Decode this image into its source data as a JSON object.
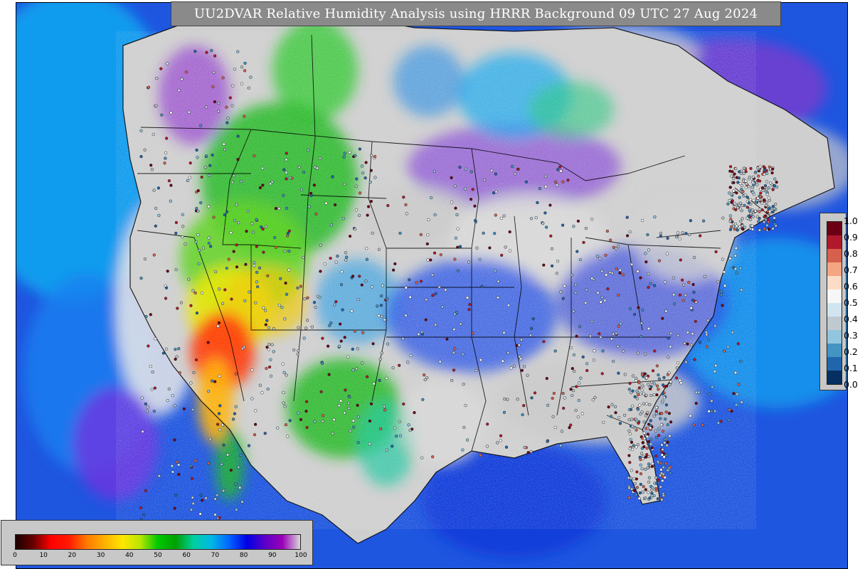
{
  "map": {
    "title": "UU2DVAR Relative Humidity Analysis using HRRR Background 09 UTC 27 Aug 2024",
    "humidity_colorbar": {
      "ticks": [
        "0",
        "10",
        "20",
        "30",
        "40",
        "50",
        "60",
        "70",
        "80",
        "90",
        "100"
      ],
      "colors": [
        "#1a0000",
        "#6a0000",
        "#ff0000",
        "#ff1a00",
        "#ff7a00",
        "#ffb000",
        "#ffe600",
        "#b8e600",
        "#00c800",
        "#00a000",
        "#00d0a0",
        "#00b8e6",
        "#0066ff",
        "#0000e6",
        "#5a00c8",
        "#9a00b8",
        "#d8d8d8"
      ]
    },
    "observation_colorbar": {
      "ticks": [
        "1.0",
        "0.9",
        "0.8",
        "0.7",
        "0.6",
        "0.5",
        "0.4",
        "0.3",
        "0.2",
        "0.1",
        "0.0"
      ],
      "colors": [
        "#6b0015",
        "#b2182b",
        "#d6604d",
        "#f4a582",
        "#fddbc7",
        "#f7f7f7",
        "#d1e5f0",
        "#bfc9d0",
        "#92c5de",
        "#4393c3",
        "#2166ac",
        "#053061"
      ]
    }
  }
}
